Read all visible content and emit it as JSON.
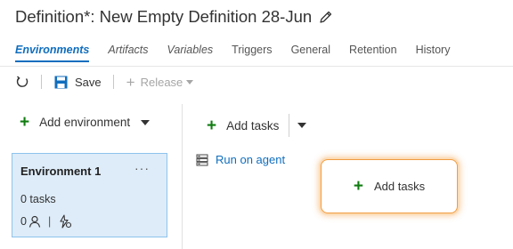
{
  "header": {
    "title": "Definition*: New Empty Definition 28-Jun"
  },
  "tabs": [
    {
      "label": "Environments",
      "active": true,
      "italic": true
    },
    {
      "label": "Artifacts",
      "active": false,
      "italic": true
    },
    {
      "label": "Variables",
      "active": false,
      "italic": true
    },
    {
      "label": "Triggers",
      "active": false,
      "italic": false
    },
    {
      "label": "General",
      "active": false,
      "italic": false
    },
    {
      "label": "Retention",
      "active": false,
      "italic": false
    },
    {
      "label": "History",
      "active": false,
      "italic": false
    }
  ],
  "toolbar": {
    "refresh_icon": "refresh-icon",
    "save_label": "Save",
    "release_label": "Release"
  },
  "left_panel": {
    "add_environment_label": "Add environment"
  },
  "environment": {
    "name": "Environment 1",
    "more": "···",
    "tasks": "0 tasks",
    "approvers_count": "0",
    "pipe": "|"
  },
  "right_panel": {
    "add_tasks_label": "Add tasks",
    "run_on_agent_label": "Run on agent",
    "add_tasks_box_label": "Add tasks"
  },
  "colors": {
    "accent": "#106ebe",
    "green": "#107c10",
    "card_bg": "#deecf9",
    "card_border": "#8ec3ec",
    "highlight": "#f29b3e"
  }
}
